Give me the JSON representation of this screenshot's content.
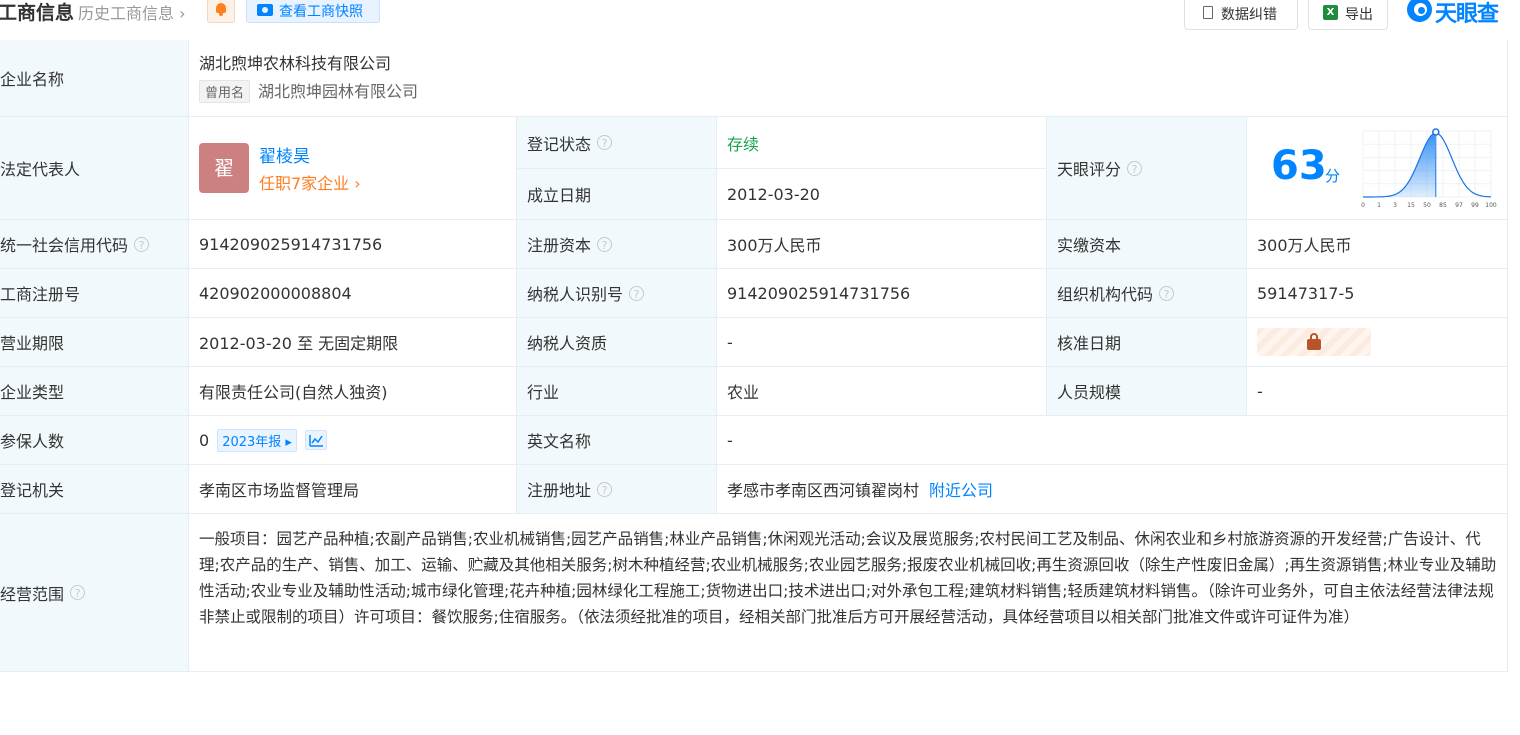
{
  "header": {
    "title": "工商信息",
    "history_link": "历史工商信息",
    "snapshot_label": "查看工商快照",
    "correction_label": "数据纠错",
    "export_label": "导出",
    "brand": "天眼查",
    "export_icon_text": "X"
  },
  "company": {
    "name_label": "企业名称",
    "name": "湖北煦坤农林科技有限公司",
    "former_tag": "曾用名",
    "former_name": "湖北煦坤园林有限公司",
    "legal_rep_label": "法定代表人",
    "legal_rep_avatar": "翟",
    "legal_rep_name": "翟棱昊",
    "legal_rep_positions": "任职7家企业",
    "reg_status_label": "登记状态",
    "reg_status": "存续",
    "est_date_label": "成立日期",
    "est_date": "2012-03-20",
    "score_label": "天眼评分",
    "score": "63",
    "score_unit": "分",
    "credit_code_label": "统一社会信用代码",
    "credit_code": "914209025914731756",
    "reg_capital_label": "注册资本",
    "reg_capital": "300万人民币",
    "paid_capital_label": "实缴资本",
    "paid_capital": "300万人民币",
    "biz_reg_no_label": "工商注册号",
    "biz_reg_no": "420902000008804",
    "taxpayer_id_label": "纳税人识别号",
    "taxpayer_id": "914209025914731756",
    "org_code_label": "组织机构代码",
    "org_code": "59147317-5",
    "term_label": "营业期限",
    "term": "2012-03-20 至 无固定期限",
    "taxpayer_qual_label": "纳税人资质",
    "taxpayer_qual": "-",
    "approval_date_label": "核准日期",
    "type_label": "企业类型",
    "type": "有限责任公司(自然人独资)",
    "industry_label": "行业",
    "industry": "农业",
    "staff_size_label": "人员规模",
    "staff_size": "-",
    "insured_label": "参保人数",
    "insured": "0",
    "report_label": "2023年报",
    "english_name_label": "英文名称",
    "english_name": "-",
    "authority_label": "登记机关",
    "authority": "孝南区市场监督管理局",
    "address_label": "注册地址",
    "address": "孝感市孝南区西河镇翟岗村",
    "nearby_label": "附近公司",
    "scope_label": "经营范围",
    "scope": "一般项目：园艺产品种植;农副产品销售;农业机械销售;园艺产品销售;林业产品销售;休闲观光活动;会议及展览服务;农村民间工艺及制品、休闲农业和乡村旅游资源的开发经营;广告设计、代理;农产品的生产、销售、加工、运输、贮藏及其他相关服务;树木种植经营;农业机械服务;农业园艺服务;报废农业机械回收;再生资源回收（除生产性废旧金属）;再生资源销售;林业专业及辅助性活动;农业专业及辅助性活动;城市绿化管理;花卉种植;园林绿化工程施工;货物进出口;技术进出口;对外承包工程;建筑材料销售;轻质建筑材料销售。（除许可业务外，可自主依法经营法律法规非禁止或限制的项目）许可项目：餐饮服务;住宿服务。（依法须经批准的项目，经相关部门批准后方可开展经营活动，具体经营项目以相关部门批准文件或许可证件为准）"
  },
  "score_chart": {
    "ticks": [
      "0",
      "1",
      "3",
      "15",
      "50",
      "85",
      "97",
      "99",
      "100"
    ],
    "marker_value": 63,
    "colors": {
      "fill": "#2e8cf5",
      "line": "#1a73e8"
    }
  },
  "colors": {
    "primary": "#0084ff",
    "label_bg": "#f2f9fc",
    "status_green": "#1aa34a",
    "accent_orange": "#ff7f1f"
  },
  "icons": {
    "bell": "bell-icon",
    "camera": "camera-icon",
    "correction": "document-icon",
    "export": "excel-icon",
    "brand": "tianyancha-logo",
    "help": "question-icon",
    "lock": "lock-icon",
    "trend": "trend-chart-icon"
  }
}
